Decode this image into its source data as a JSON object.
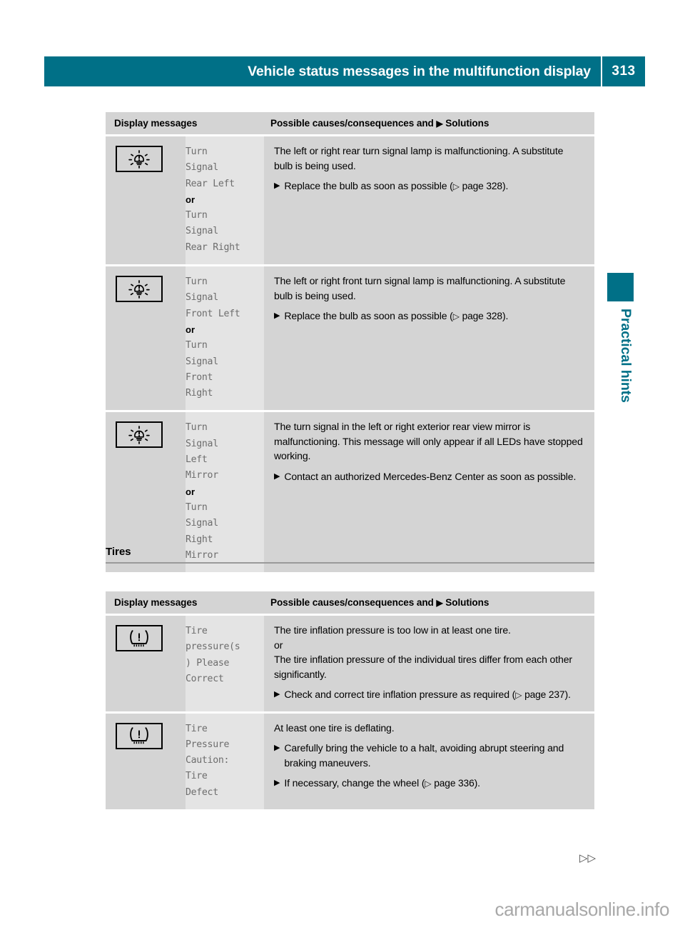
{
  "header": {
    "title": "Vehicle status messages in the multifunction display",
    "page_number": "313",
    "accent_color": "#007087"
  },
  "side_tab": {
    "label": "Practical hints",
    "color": "#007087"
  },
  "tables": [
    {
      "id": "table-1",
      "columns": {
        "display_messages": "Display messages",
        "solutions_prefix": "Possible causes/consequences and",
        "solutions_marker": "▶",
        "solutions_suffix": "Solutions"
      },
      "rows": [
        {
          "icon": "bulb-warning-icon",
          "message_lines": [
            {
              "text": "Turn",
              "style": "mono"
            },
            {
              "text": "Signal",
              "style": "mono"
            },
            {
              "text": "Rear Left",
              "style": "mono"
            },
            {
              "text": "or",
              "style": "bold"
            },
            {
              "text": "Turn",
              "style": "mono"
            },
            {
              "text": "Signal",
              "style": "mono"
            },
            {
              "text": "Rear Right",
              "style": "mono"
            }
          ],
          "cause": "The left or right rear turn signal lamp is malfunctioning. A substitute bulb is being used.",
          "bullets": [
            {
              "text": "Replace the bulb as soon as possible (",
              "ref": "page 328",
              "tail": ")."
            }
          ]
        },
        {
          "icon": "bulb-warning-icon",
          "message_lines": [
            {
              "text": "Turn",
              "style": "mono"
            },
            {
              "text": "Signal",
              "style": "mono"
            },
            {
              "text": "Front Left",
              "style": "mono"
            },
            {
              "text": "or",
              "style": "bold"
            },
            {
              "text": "Turn",
              "style": "mono"
            },
            {
              "text": "Signal",
              "style": "mono"
            },
            {
              "text": "Front",
              "style": "mono"
            },
            {
              "text": "Right",
              "style": "mono"
            }
          ],
          "cause": "The left or right front turn signal lamp is malfunctioning. A substitute bulb is being used.",
          "bullets": [
            {
              "text": "Replace the bulb as soon as possible (",
              "ref": "page 328",
              "tail": ")."
            }
          ]
        },
        {
          "icon": "bulb-warning-icon",
          "message_lines": [
            {
              "text": "Turn",
              "style": "mono"
            },
            {
              "text": "Signal",
              "style": "mono"
            },
            {
              "text": "Left",
              "style": "mono"
            },
            {
              "text": "Mirror",
              "style": "mono"
            },
            {
              "text": "or",
              "style": "bold"
            },
            {
              "text": "Turn",
              "style": "mono"
            },
            {
              "text": "Signal",
              "style": "mono"
            },
            {
              "text": "Right",
              "style": "mono"
            },
            {
              "text": "Mirror",
              "style": "mono"
            }
          ],
          "cause": "The turn signal in the left or right exterior rear view mirror is malfunctioning. This message will only appear if all LEDs have stopped working.",
          "bullets": [
            {
              "text": "Contact an authorized Mercedes-Benz Center as soon as possible.",
              "ref": "",
              "tail": ""
            }
          ]
        }
      ]
    },
    {
      "id": "table-2",
      "heading": "Tires",
      "columns": {
        "display_messages": "Display messages",
        "solutions_prefix": "Possible causes/consequences and",
        "solutions_marker": "▶",
        "solutions_suffix": "Solutions"
      },
      "rows": [
        {
          "icon": "tire-pressure-warning-icon",
          "message_lines": [
            {
              "text": "Tire",
              "style": "mono"
            },
            {
              "text": "pressure(s",
              "style": "mono"
            },
            {
              "text": ") Please",
              "style": "mono"
            },
            {
              "text": "Correct",
              "style": "mono"
            }
          ],
          "cause": "The tire inflation pressure is too low in at least one tire.",
          "cause_or": "or",
          "cause2": "The tire inflation pressure of the individual tires differ from each other significantly.",
          "bullets": [
            {
              "text": "Check and correct tire inflation pressure as required (",
              "ref": "page 237",
              "tail": ")."
            }
          ]
        },
        {
          "icon": "tire-pressure-warning-icon",
          "message_lines": [
            {
              "text": "Tire",
              "style": "mono"
            },
            {
              "text": "Pressure",
              "style": "mono"
            },
            {
              "text": "Caution:",
              "style": "mono"
            },
            {
              "text": "Tire",
              "style": "mono"
            },
            {
              "text": "Defect",
              "style": "mono"
            }
          ],
          "cause": "At least one tire is deflating.",
          "bullets": [
            {
              "text": "Carefully bring the vehicle to a halt, avoiding abrupt steering and braking maneuvers.",
              "ref": "",
              "tail": ""
            },
            {
              "text": "If necessary, change the wheel (",
              "ref": "page 336",
              "tail": ")."
            }
          ]
        }
      ]
    }
  ],
  "footer": {
    "continuation_marker": "▷▷",
    "watermark": "carmanualsonline.info"
  }
}
